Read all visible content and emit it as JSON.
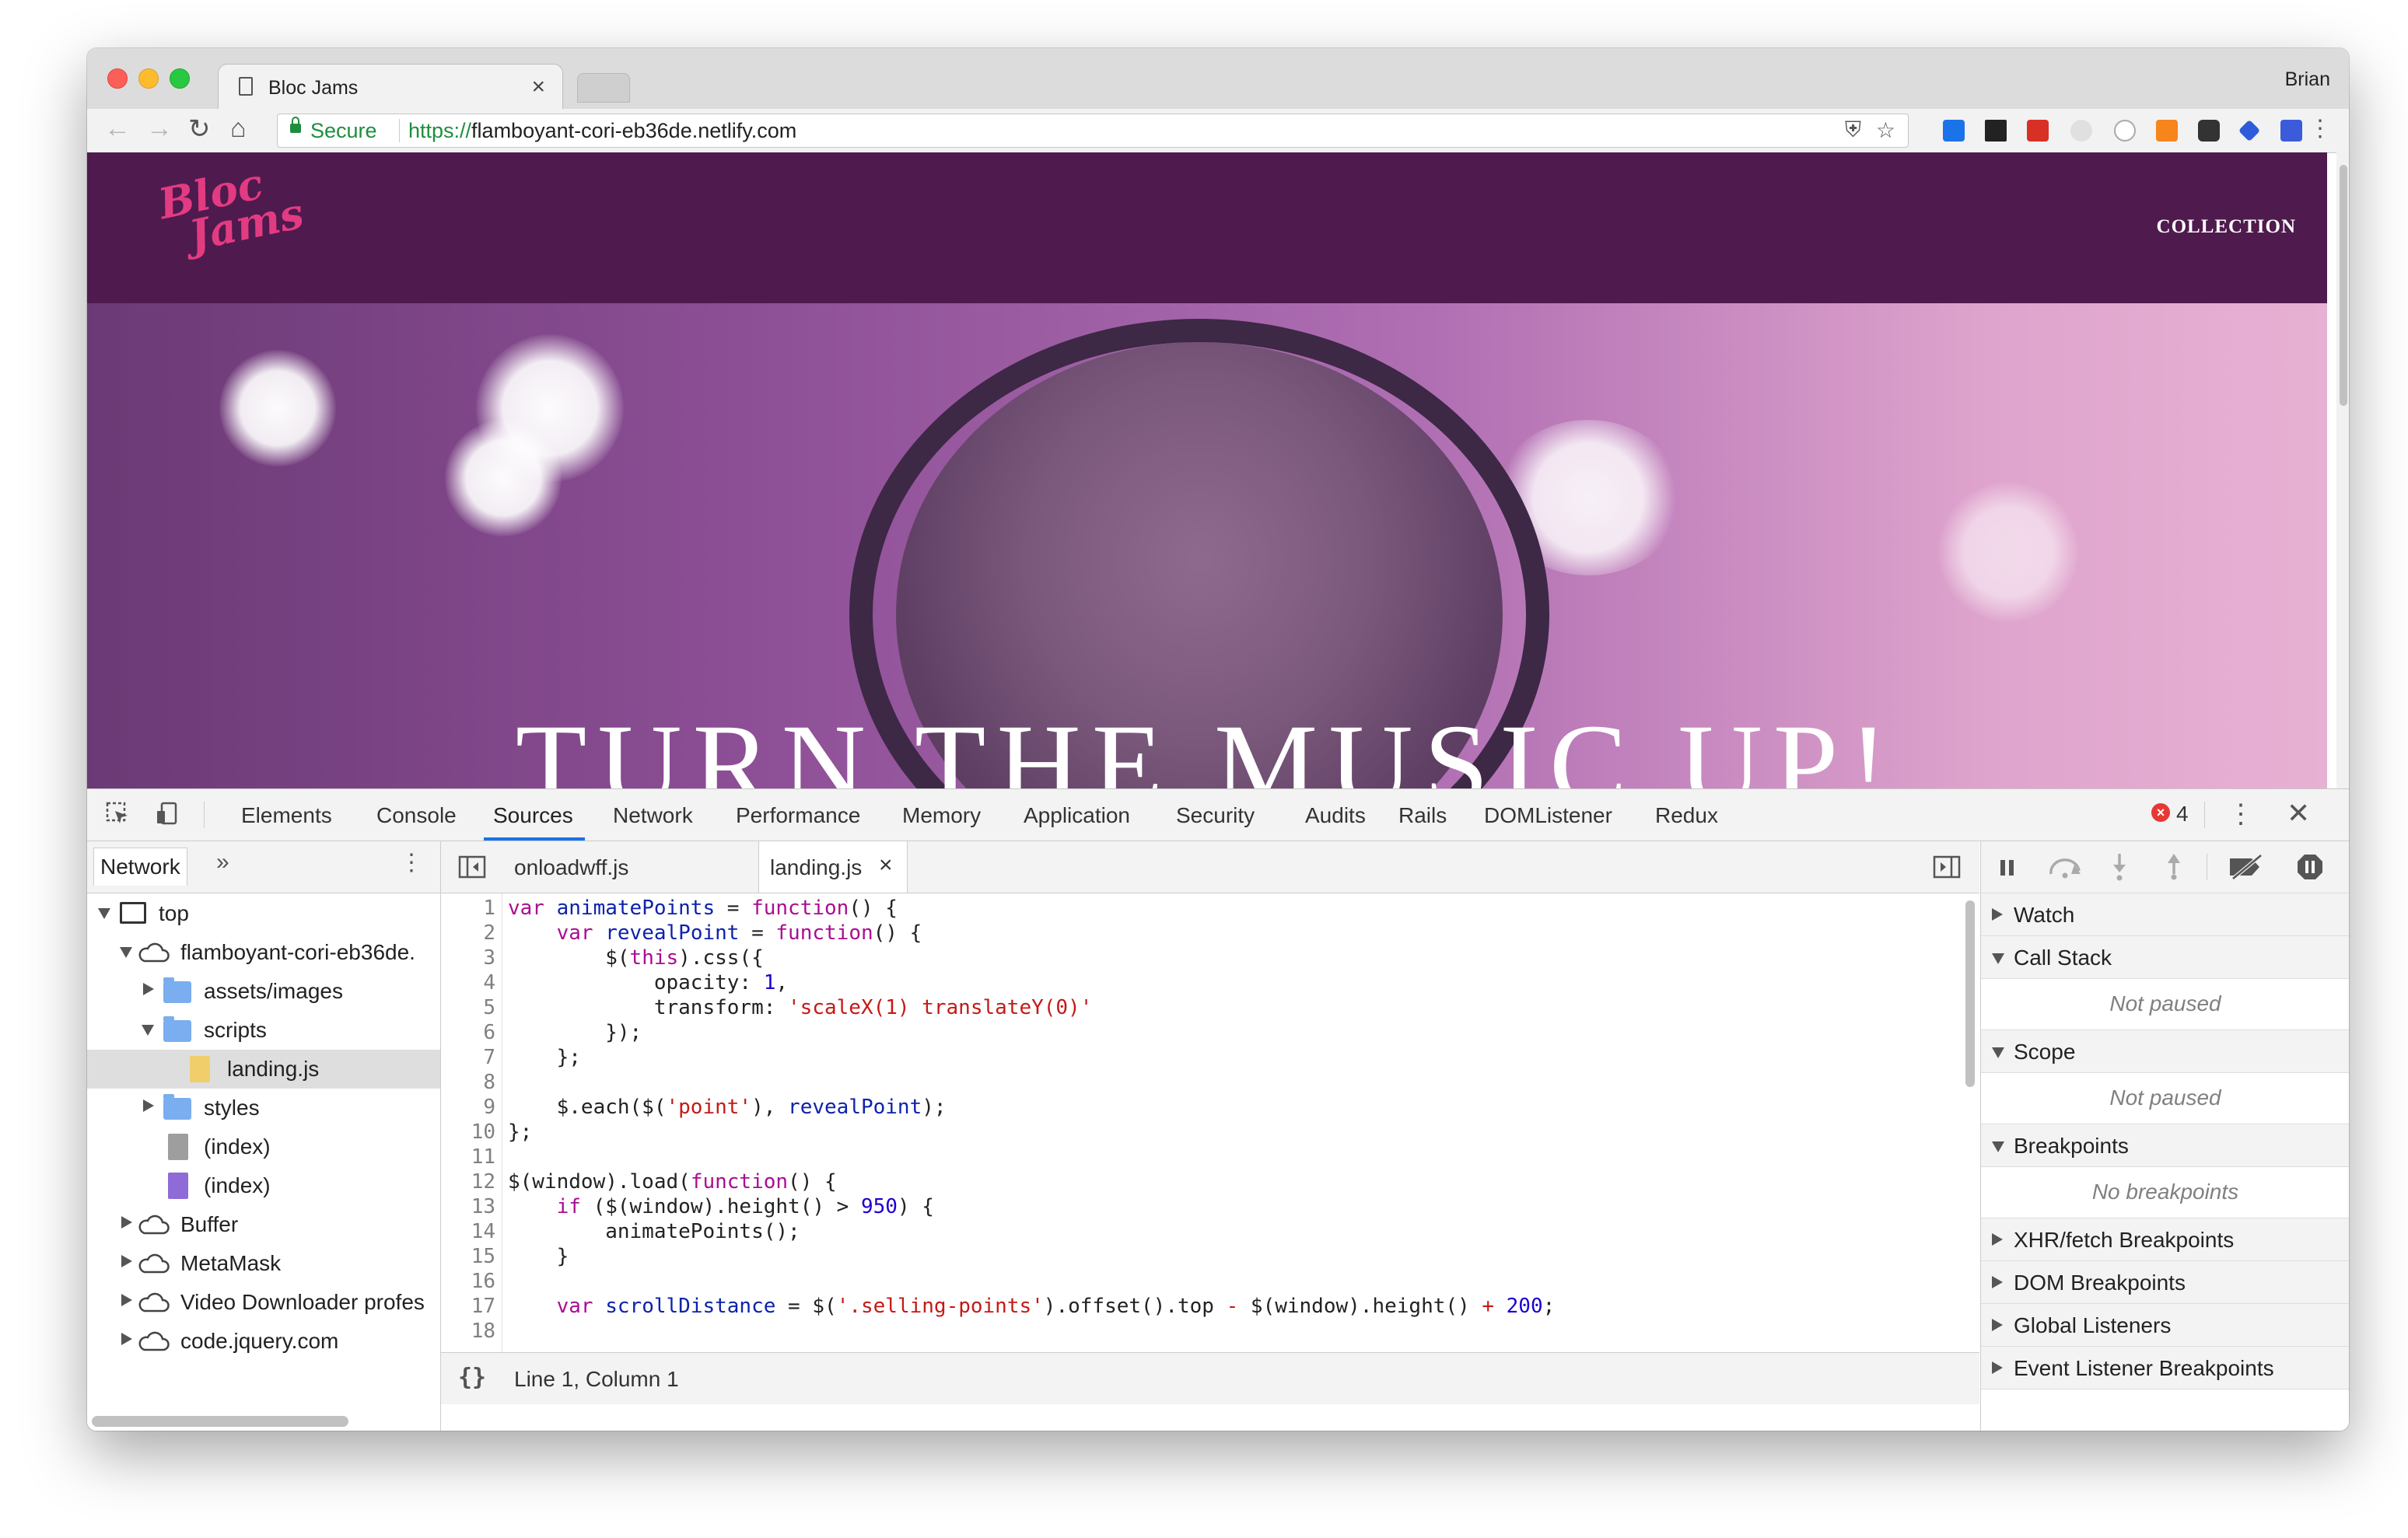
{
  "browser": {
    "tab_title": "Bloc Jams",
    "tab_close": "×",
    "profile": "Brian",
    "nav": {
      "back": "←",
      "forward": "→",
      "reload": "↻",
      "home": "⌂"
    },
    "secure_label": "Secure",
    "url_scheme": "https://",
    "url_host": "flamboyant-cori-eb36de.netlify.com",
    "menu": "⋮"
  },
  "page": {
    "logo_line1": "Bloc",
    "logo_line2": "Jams",
    "nav_link": "COLLECTION",
    "hero_title": "TURN THE MUSIC UP!"
  },
  "devtools": {
    "tabs": [
      "Elements",
      "Console",
      "Sources",
      "Network",
      "Performance",
      "Memory",
      "Application",
      "Security",
      "Audits",
      "Rails",
      "DOMListener",
      "Redux"
    ],
    "active_tab": "Sources",
    "error_count": "4",
    "navigator": {
      "tab": "Network",
      "more": "»",
      "tree": {
        "top": "top",
        "site": "flamboyant-cori-eb36de.",
        "assets": "assets/images",
        "scripts": "scripts",
        "landing": "landing.js",
        "styles": "styles",
        "index1": "(index)",
        "index2": "(index)",
        "buffer": "Buffer",
        "metamask": "MetaMask",
        "video": "Video Downloader profes",
        "jquery": "code.jquery.com"
      }
    },
    "editor": {
      "tabs": [
        "onloadwff.js",
        "landing.js"
      ],
      "active_tab": "landing.js",
      "tab_close": "×",
      "line_numbers": [
        "1",
        "2",
        "3",
        "4",
        "5",
        "6",
        "7",
        "8",
        "9",
        "10",
        "11",
        "12",
        "13",
        "14",
        "15",
        "16",
        "17",
        "18"
      ],
      "status": "Line 1, Column 1",
      "pretty_print": "{}"
    },
    "debugger": {
      "watch": "Watch",
      "call_stack": "Call Stack",
      "not_paused_1": "Not paused",
      "scope": "Scope",
      "not_paused_2": "Not paused",
      "breakpoints": "Breakpoints",
      "no_breakpoints": "No breakpoints",
      "xhr": "XHR/fetch Breakpoints",
      "dom": "DOM Breakpoints",
      "global": "Global Listeners",
      "event": "Event Listener Breakpoints"
    }
  }
}
